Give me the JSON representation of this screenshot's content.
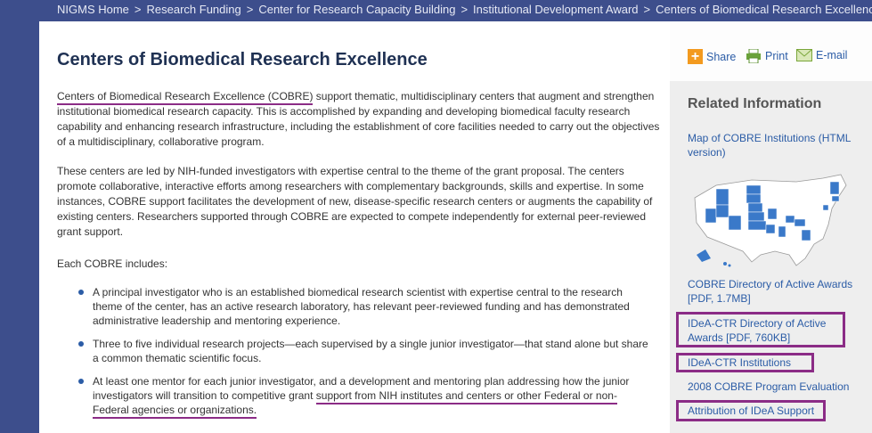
{
  "breadcrumb": {
    "items": [
      "NIGMS Home",
      "Research Funding",
      "Center for Research Capacity Building",
      "Institutional Development Award",
      "Centers of Biomedical Research Excellence"
    ],
    "separator": ">"
  },
  "page": {
    "title": "Centers of Biomedical Research Excellence",
    "intro_link": "Centers of Biomedical Research Excellence (COBRE)",
    "intro_rest": " support thematic, multidisciplinary centers that augment and strengthen institutional biomedical research capacity. This is accomplished by expanding and developing biomedical faculty research capability and enhancing research infrastructure, including the establishment of core facilities needed to carry out the objectives of a multidisciplinary, collaborative program.",
    "para2": "These centers are led by NIH-funded investigators with expertise central to the theme of the grant proposal. The centers promote collaborative, interactive efforts among researchers with complementary backgrounds, skills and expertise. In some instances, COBRE support facilitates the development of new, disease-specific research centers or augments the capability of existing centers. Researchers supported through COBRE are expected to compete independently for external peer-reviewed grant support.",
    "para3": "Each COBRE includes:",
    "bullets": [
      "A principal investigator who is an established biomedical research scientist with expertise central to the research theme of the center, has an active research laboratory, has relevant peer-reviewed funding and has demonstrated administrative leadership and mentoring experience.",
      "Three to five individual research projects—each supervised by a single junior investigator—that stand alone but share a common thematic scientific focus."
    ],
    "bullet3_a": "At least one mentor for each junior investigator, and a development and mentoring plan addressing how the junior investigators will transition to competitive grant ",
    "bullet3_b": "support from NIH institutes and centers or other Federal or non-Federal agencies or organizations."
  },
  "tools": {
    "share": "Share",
    "print": "Print",
    "email": "E-mail"
  },
  "sidebar": {
    "title": "Related Information",
    "links": [
      "Map of COBRE Institutions (HTML version)",
      "COBRE Directory of Active Awards [PDF, 1.7MB]",
      "IDeA-CTR Directory of Active Awards [PDF, 760KB]",
      "IDeA-CTR Institutions",
      "2008 COBRE Program Evaluation",
      "Attribution of IDeA Support"
    ]
  },
  "colors": {
    "header": "#3d4e8c",
    "link": "#2b5ca6",
    "highlight": "#8b2c86",
    "title": "#1f3153"
  }
}
